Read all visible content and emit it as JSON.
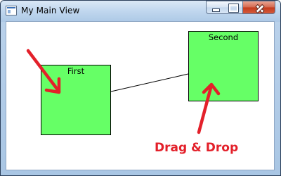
{
  "window": {
    "title": "My Main View",
    "controls": {
      "minimize": "minimize",
      "maximize": "maximize",
      "close": "close"
    }
  },
  "canvas": {
    "boxes": [
      {
        "label": "First"
      },
      {
        "label": "Second"
      }
    ],
    "box_color": "#66ff66",
    "connector_color": "#000000"
  },
  "annotation": {
    "text": "Drag & Drop",
    "color": "#e3202a"
  },
  "icons": [
    "app-window-icon",
    "minimize-icon",
    "maximize-icon",
    "close-icon",
    "arrow-icon"
  ]
}
